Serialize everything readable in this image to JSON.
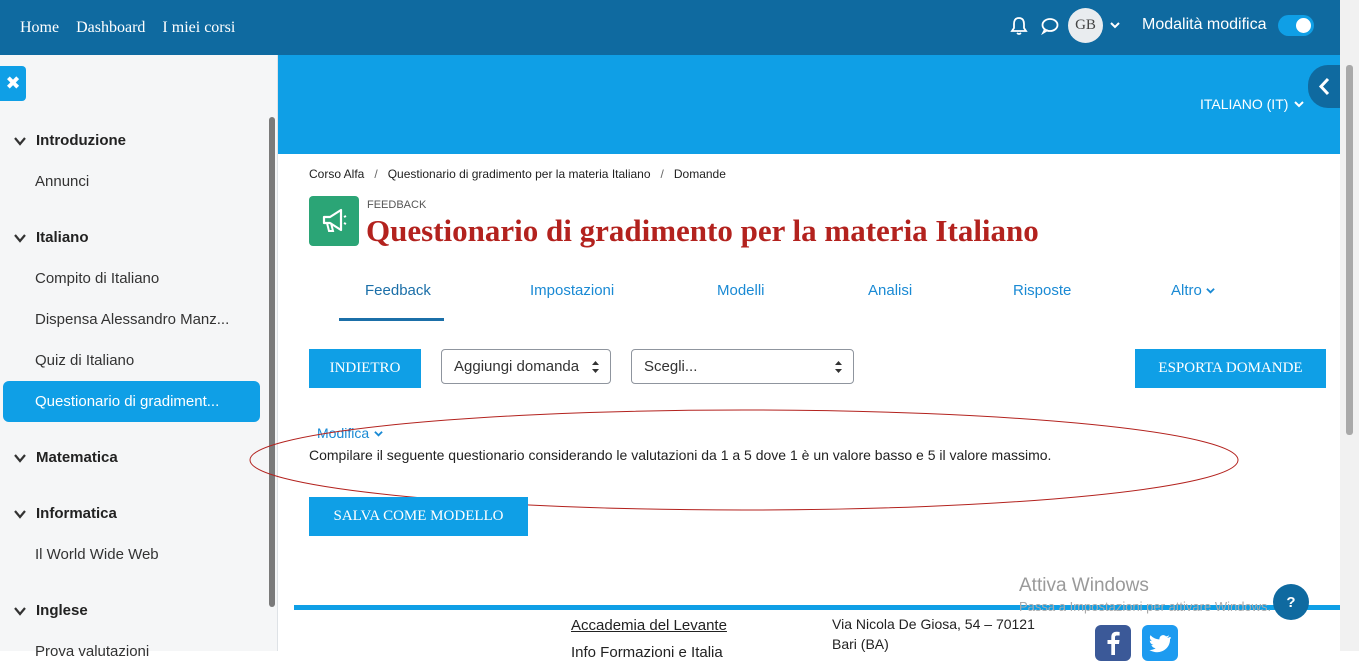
{
  "topbar": {
    "nav": [
      "Home",
      "Dashboard",
      "I miei corsi"
    ],
    "avatar_initials": "GB",
    "edit_mode_label": "Modalità modifica",
    "edit_mode_on": true
  },
  "sidebar": {
    "close_glyph": "✖",
    "sections": [
      {
        "label": "Introduzione",
        "items": [
          "Annunci"
        ]
      },
      {
        "label": "Italiano",
        "items": [
          "Compito di Italiano",
          "Dispensa Alessandro Manz...",
          "Quiz di Italiano",
          "Questionario di gradiment..."
        ]
      },
      {
        "label": "Matematica",
        "items": []
      },
      {
        "label": "Informatica",
        "items": [
          "Il World Wide Web"
        ]
      },
      {
        "label": "Inglese",
        "items": [
          "Prova valutazioni"
        ]
      }
    ],
    "active_item": "Questionario di gradiment..."
  },
  "header": {
    "language": "ITALIANO (IT)"
  },
  "breadcrumb": [
    "Corso Alfa",
    "Questionario di gradimento per la materia Italiano",
    "Domande"
  ],
  "module": {
    "type_label": "FEEDBACK",
    "title": "Questionario di gradimento per la materia Italiano"
  },
  "tabs": [
    {
      "label": "Feedback",
      "active": true
    },
    {
      "label": "Impostazioni",
      "active": false
    },
    {
      "label": "Modelli",
      "active": false
    },
    {
      "label": "Analisi",
      "active": false
    },
    {
      "label": "Risposte",
      "active": false
    },
    {
      "label": "Altro",
      "active": false
    }
  ],
  "actions": {
    "back_label": "INDIETRO",
    "add_question_value": "Aggiungi domanda",
    "choose_value": "Scegli...",
    "export_label": "ESPORTA DOMANDE",
    "save_template_label": "SALVA COME MODELLO"
  },
  "item": {
    "edit_label": "Modifica",
    "description": "Compilare il seguente questionario considerando le valutazioni da 1 a 5 dove 1 è un valore basso e 5 il valore massimo."
  },
  "footer": {
    "org_name": "Accademia del Levante",
    "org_sub": "Info Formazioni e Italia",
    "address_line1": "Via Nicola De Giosa, 54 – 70121",
    "address_line2": "Bari (BA)"
  },
  "help_label": "?",
  "watermark": {
    "title": "Attiva Windows",
    "subtitle": "Passa a Impostazioni per attivare Windows."
  },
  "colors": {
    "navbar": "#0f6aa0",
    "accent": "#0f9fe6",
    "title_red": "#b3221e",
    "module_green": "#2ba576"
  }
}
